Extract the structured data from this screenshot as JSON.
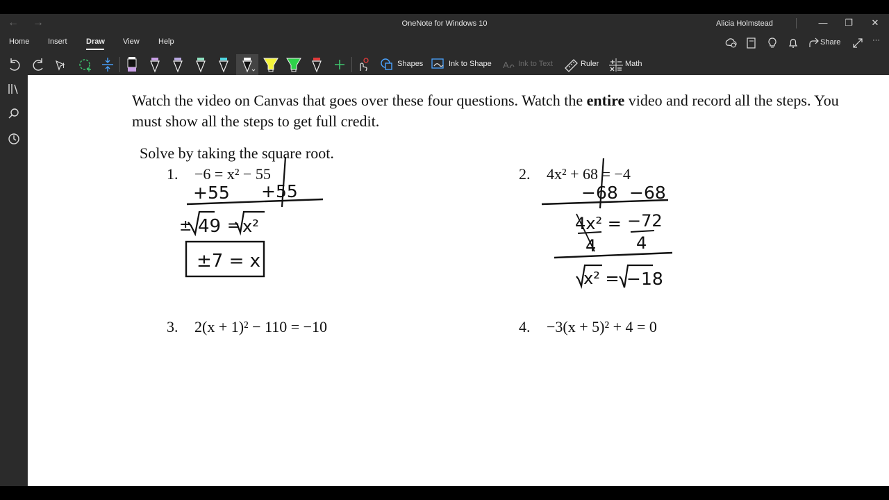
{
  "titlebar": {
    "back_arrow": "←",
    "forward_arrow": "→",
    "app_title": "OneNote for Windows 10",
    "user_name": "Alicia Holmstead",
    "minimize": "—",
    "restore": "❐",
    "close": "✕"
  },
  "ribbon": {
    "tabs": [
      {
        "label": "Home"
      },
      {
        "label": "Insert"
      },
      {
        "label": "Draw"
      },
      {
        "label": "View"
      },
      {
        "label": "Help"
      }
    ],
    "active_tab": "Draw",
    "share_label": "Share",
    "more": "···"
  },
  "toolbar": {
    "shapes_label": "Shapes",
    "ink_to_shape_label": "Ink to Shape",
    "ink_to_text_label": "Ink to Text",
    "ruler_label": "Ruler",
    "math_label": "Math",
    "pens": [
      {
        "icon": "pen-black-icon",
        "color": "#111111"
      },
      {
        "icon": "pen-violet-icon",
        "color": "#c9a0e6"
      },
      {
        "icon": "pen-lavender-icon",
        "color": "#b8a8e0"
      },
      {
        "icon": "pen-mint-icon",
        "color": "#8fe0c0"
      },
      {
        "icon": "pen-teal-icon",
        "color": "#4fd6e0"
      },
      {
        "icon": "pen-black-selected-icon",
        "color": "#111111"
      },
      {
        "icon": "highlighter-yellow-icon",
        "color": "#f4f43a"
      },
      {
        "icon": "highlighter-green-icon",
        "color": "#2ed34a"
      },
      {
        "icon": "pen-red-icon",
        "color": "#e03a3a"
      }
    ]
  },
  "page": {
    "instructions": {
      "part1": "Watch the video on Canvas that goes over these four questions. Watch the ",
      "emphasis": "entire",
      "part2": " video and record all the steps. You must show all the steps to get full credit."
    },
    "subheading": "Solve by taking the square root.",
    "problems": [
      {
        "number": "1.",
        "equation": "−6 = x² − 55"
      },
      {
        "number": "2.",
        "equation": "4x² + 68 = −4"
      },
      {
        "number": "3.",
        "equation": "2(x + 1)² − 110 = −10"
      },
      {
        "number": "4.",
        "equation": "−3(x + 5)² + 4 = 0"
      }
    ],
    "handwriting": {
      "p1_line1_left": "+55",
      "p1_line1_right": "+55",
      "p1_line2_left": "±",
      "p1_line2_value": "49",
      "p1_line2_eq": "=",
      "p1_line2_rhs": "x²",
      "p1_answer": "±7 = x",
      "p2_line1_left": "−68",
      "p2_line1_right": "−68",
      "p2_frac_left_num": "4x² =",
      "p2_frac_left_den": "4",
      "p2_frac_right_num": "−72",
      "p2_frac_right_den": "4",
      "p2_line3_lhs": "x² =",
      "p2_line3_rhs": "−18"
    },
    "ink_color": "#111111",
    "accent_color": "#ffffff"
  }
}
